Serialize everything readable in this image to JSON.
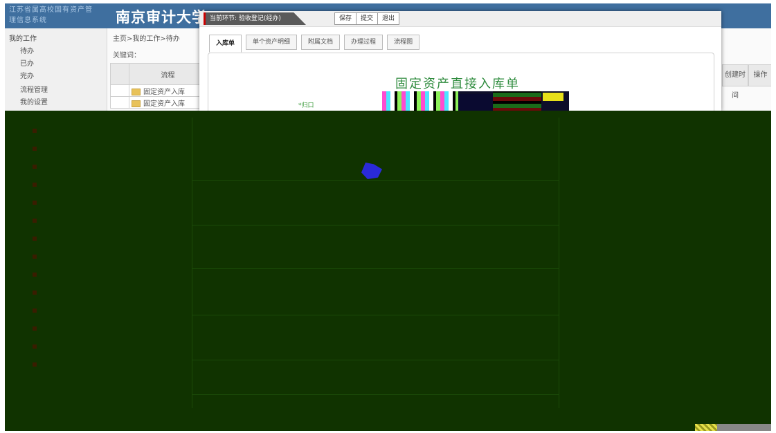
{
  "banner": {
    "system_name": "江苏省属高校国有资产管理信息系统",
    "university": "南京审计大学"
  },
  "leftnav": {
    "root": "我的工作",
    "items": [
      "待办",
      "已办",
      "完办",
      "流程管理",
      "我的设置"
    ]
  },
  "content": {
    "breadcrumb": "主页>我的工作>待办",
    "keyword_label": "关键词：",
    "table_header": "流程",
    "rows": [
      "固定资产入库",
      "固定资产入库"
    ],
    "right_headers": [
      "创建时间",
      "操作"
    ]
  },
  "modal": {
    "current_step": "当前环节: 验收登记(经办)",
    "buttons": [
      "保存",
      "提交",
      "退出"
    ],
    "tabs": [
      "入库单",
      "单个资产明细",
      "附属文档",
      "办理过程",
      "流程图"
    ],
    "form_title": "固定资产直接入库单",
    "hint": "*归口"
  }
}
